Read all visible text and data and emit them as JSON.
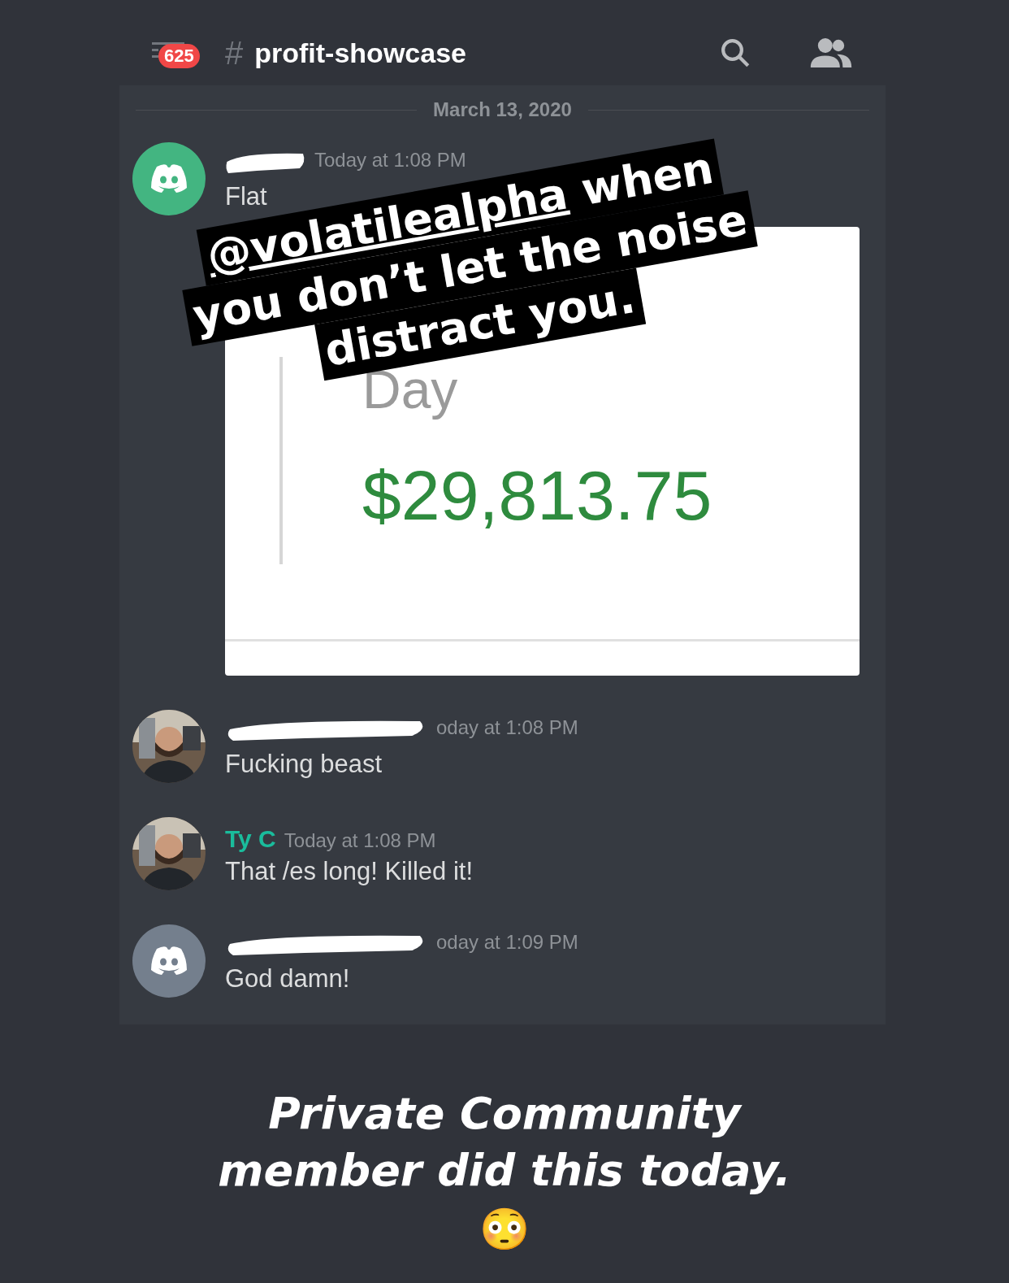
{
  "header": {
    "unread_badge": "625",
    "channel_hash": "#",
    "channel_name": "profit-showcase"
  },
  "date_divider": "March 13, 2020",
  "messages": [
    {
      "avatar": {
        "kind": "logo",
        "color": "#43b581"
      },
      "redacted": true,
      "timestamp": "Today at 1:08 PM",
      "text": "Flat",
      "attachment": {
        "label": "Day",
        "amount": "$29,813.75"
      }
    },
    {
      "redacted": true,
      "timestamp": "oday at 1:08 PM",
      "text": "Fucking beast"
    },
    {
      "redacted": false,
      "username": "Ty C",
      "color": "#1abc9c",
      "timestamp": "Today at 1:08 PM",
      "text": "That /es long! Killed it!"
    },
    {
      "avatar": {
        "kind": "logo",
        "color": "#747f8d"
      },
      "redacted": true,
      "timestamp": "oday at 1:09 PM",
      "text": "God damn!"
    }
  ],
  "sticker": {
    "lines": [
      {
        "mention": "@volatilealpha",
        "text": " when"
      },
      {
        "text": "you don’t let the noise"
      },
      {
        "text": "distract you."
      }
    ]
  },
  "caption": {
    "lines": [
      "Private Community",
      "member did this today."
    ],
    "emoji": "😳"
  }
}
